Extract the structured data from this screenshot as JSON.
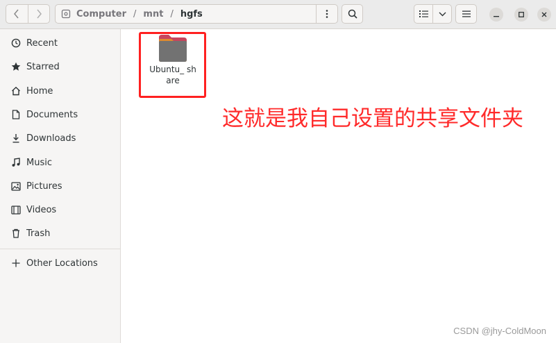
{
  "path": {
    "segments": [
      "Computer",
      "mnt",
      "hgfs"
    ],
    "separator": "/"
  },
  "sidebar": {
    "items": [
      {
        "label": "Recent",
        "icon": "clock-icon"
      },
      {
        "label": "Starred",
        "icon": "star-icon"
      },
      {
        "label": "Home",
        "icon": "home-icon"
      },
      {
        "label": "Documents",
        "icon": "document-icon"
      },
      {
        "label": "Downloads",
        "icon": "download-icon"
      },
      {
        "label": "Music",
        "icon": "music-icon"
      },
      {
        "label": "Pictures",
        "icon": "picture-icon"
      },
      {
        "label": "Videos",
        "icon": "video-icon"
      },
      {
        "label": "Trash",
        "icon": "trash-icon"
      }
    ],
    "other_locations": "Other Locations"
  },
  "files": [
    {
      "name": "Ubuntu_ share",
      "icon": "folder-icon"
    }
  ],
  "annotation": "这就是我自己设置的共享文件夹",
  "watermark": "CSDN @jhy-ColdMoon",
  "colors": {
    "accent": "#ff2020",
    "folder_top": "#c7455d",
    "folder_body": "#727272"
  }
}
